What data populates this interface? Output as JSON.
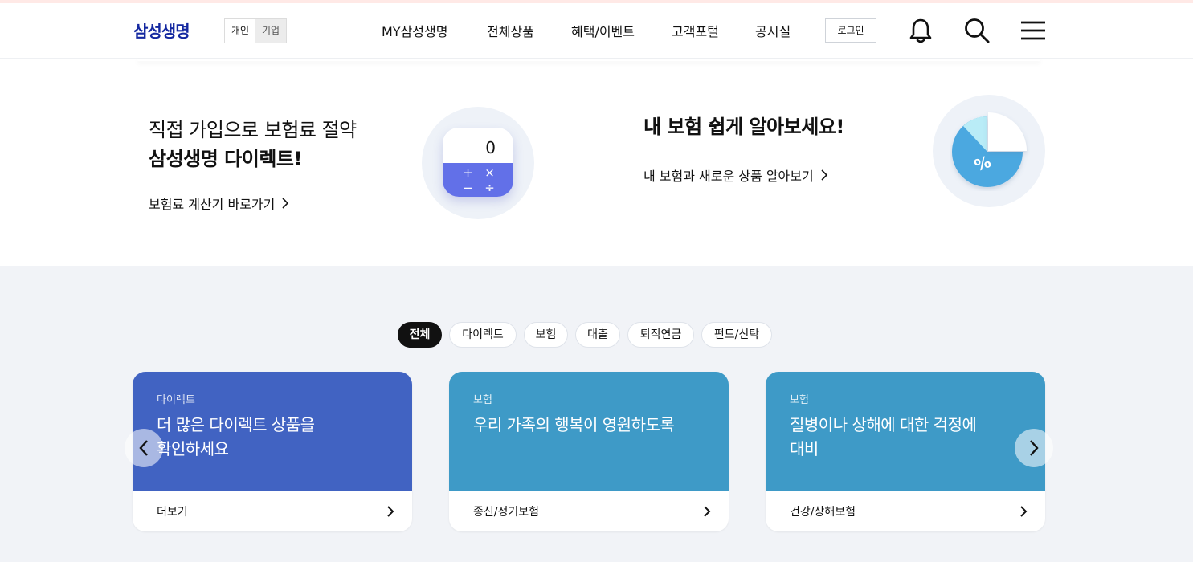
{
  "header": {
    "logo": "삼성생명",
    "segments": [
      "개인",
      "기업"
    ],
    "nav": [
      "MY삼성생명",
      "전체상품",
      "혜택/이벤트",
      "고객포털",
      "공시실"
    ],
    "login_label": "로그인",
    "icons": [
      "bell-icon",
      "search-icon",
      "menu-icon"
    ]
  },
  "promo_left": {
    "line1": "직접 가입으로 보험료 절약",
    "line2": "삼성생명 다이렉트!",
    "link": "보험료 계산기 바로가기",
    "calc_display": "0",
    "calc_keys": [
      "+",
      "×",
      "−",
      "÷"
    ]
  },
  "promo_right": {
    "title": "내 보험 쉽게 알아보세요!",
    "link": "내 보험과 새로운 상품 알아보기",
    "icon": "percent-pie-icon"
  },
  "chips": [
    "전체",
    "다이렉트",
    "보험",
    "대출",
    "퇴직연금",
    "펀드/신탁"
  ],
  "active_chip": "전체",
  "cards": [
    {
      "category": "다이렉트",
      "title_line1": "더 많은 다이렉트 상품을",
      "title_line2": "확인하세요",
      "link": "더보기",
      "color": "#4163c2"
    },
    {
      "category": "보험",
      "title_line1": "우리 가족의 행복이 영원하도록",
      "title_line2": "",
      "link": "종신/정기보험",
      "color": "#3e9ac7"
    },
    {
      "category": "보험",
      "title_line1": "질병이나 상해에 대한 걱정에",
      "title_line2": "대비",
      "link": "건강/상해보험",
      "color": "#3e9ac7"
    }
  ],
  "colors": {
    "brand": "#1428a0",
    "calc_keys": "#6270e8",
    "pie": "#4ba8e0",
    "pie_light": "#b9ecf7"
  }
}
